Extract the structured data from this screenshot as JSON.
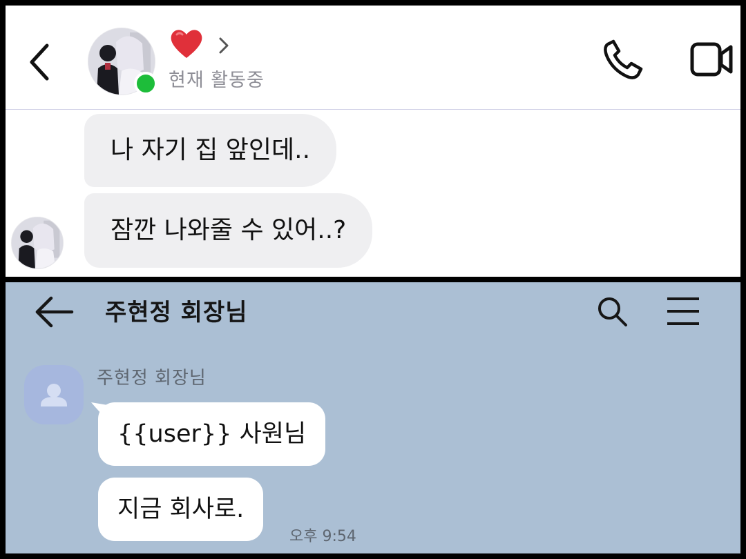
{
  "top_chat": {
    "contact_name_emoji": "❤️",
    "status": "현재 활동중",
    "messages": [
      "나 자기 집 앞인데..",
      "잠깐 나와줄 수 있어..?"
    ],
    "colors": {
      "online": "#1dbd3a",
      "bubble": "#efeff1",
      "heart": "#e0303a"
    }
  },
  "bottom_chat": {
    "room_title": "주현정 회장님",
    "sender_name": "주현정 회장님",
    "messages": [
      "{{user}} 사원님",
      "지금 회사로."
    ],
    "timestamp": "오후 9:54",
    "colors": {
      "background": "#abbfd4",
      "bubble": "#ffffff",
      "profile": "#a6b7de"
    }
  }
}
